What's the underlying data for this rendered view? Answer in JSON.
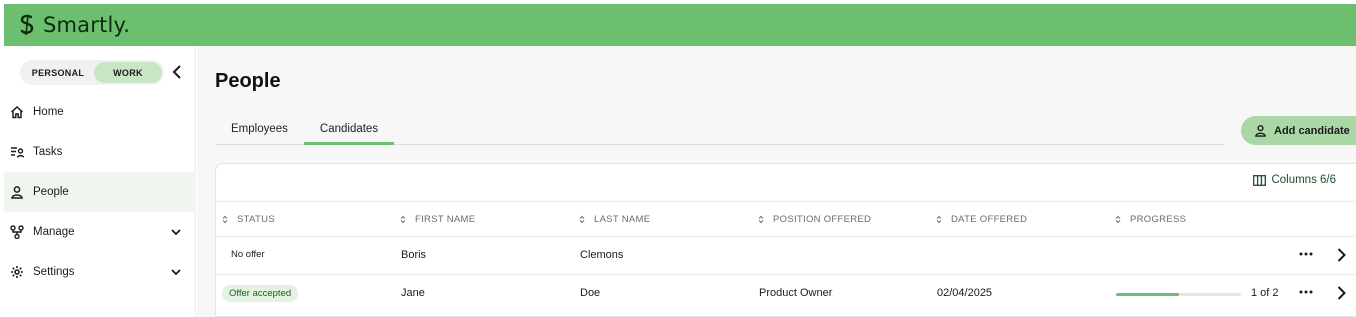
{
  "app": {
    "brand": "Smartly."
  },
  "sidebar": {
    "toggle": {
      "personal": "PERSONAL",
      "work": "WORK"
    },
    "items": [
      {
        "label": "Home",
        "icon": "home-icon"
      },
      {
        "label": "Tasks",
        "icon": "tasks-icon"
      },
      {
        "label": "People",
        "icon": "person-icon",
        "active": true
      },
      {
        "label": "Manage",
        "icon": "org-chart-icon",
        "expandable": true
      },
      {
        "label": "Settings",
        "icon": "gear-icon",
        "expandable": true
      }
    ]
  },
  "main": {
    "title": "People",
    "tabs": [
      {
        "label": "Employees"
      },
      {
        "label": "Candidates",
        "active": true
      }
    ],
    "add_button": "Add candidate",
    "columns_label": "Columns 6/6",
    "table": {
      "headers": [
        "STATUS",
        "FIRST NAME",
        "LAST NAME",
        "POSITION OFFERED",
        "DATE OFFERED",
        "PROGRESS"
      ],
      "rows": [
        {
          "status": "No offer",
          "first_name": "Boris",
          "last_name": "Clemons",
          "position": "",
          "date": "",
          "progress_text": ""
        },
        {
          "status": "Offer accepted",
          "first_name": "Jane",
          "last_name": "Doe",
          "position": "Product Owner",
          "date": "02/04/2025",
          "progress_text": "1 of 2",
          "progress": 0.5
        }
      ]
    }
  },
  "colors": {
    "accent": "#6bbf6e",
    "accent_light": "#c8e6c5",
    "badge_bg": "#e4f2e2"
  }
}
